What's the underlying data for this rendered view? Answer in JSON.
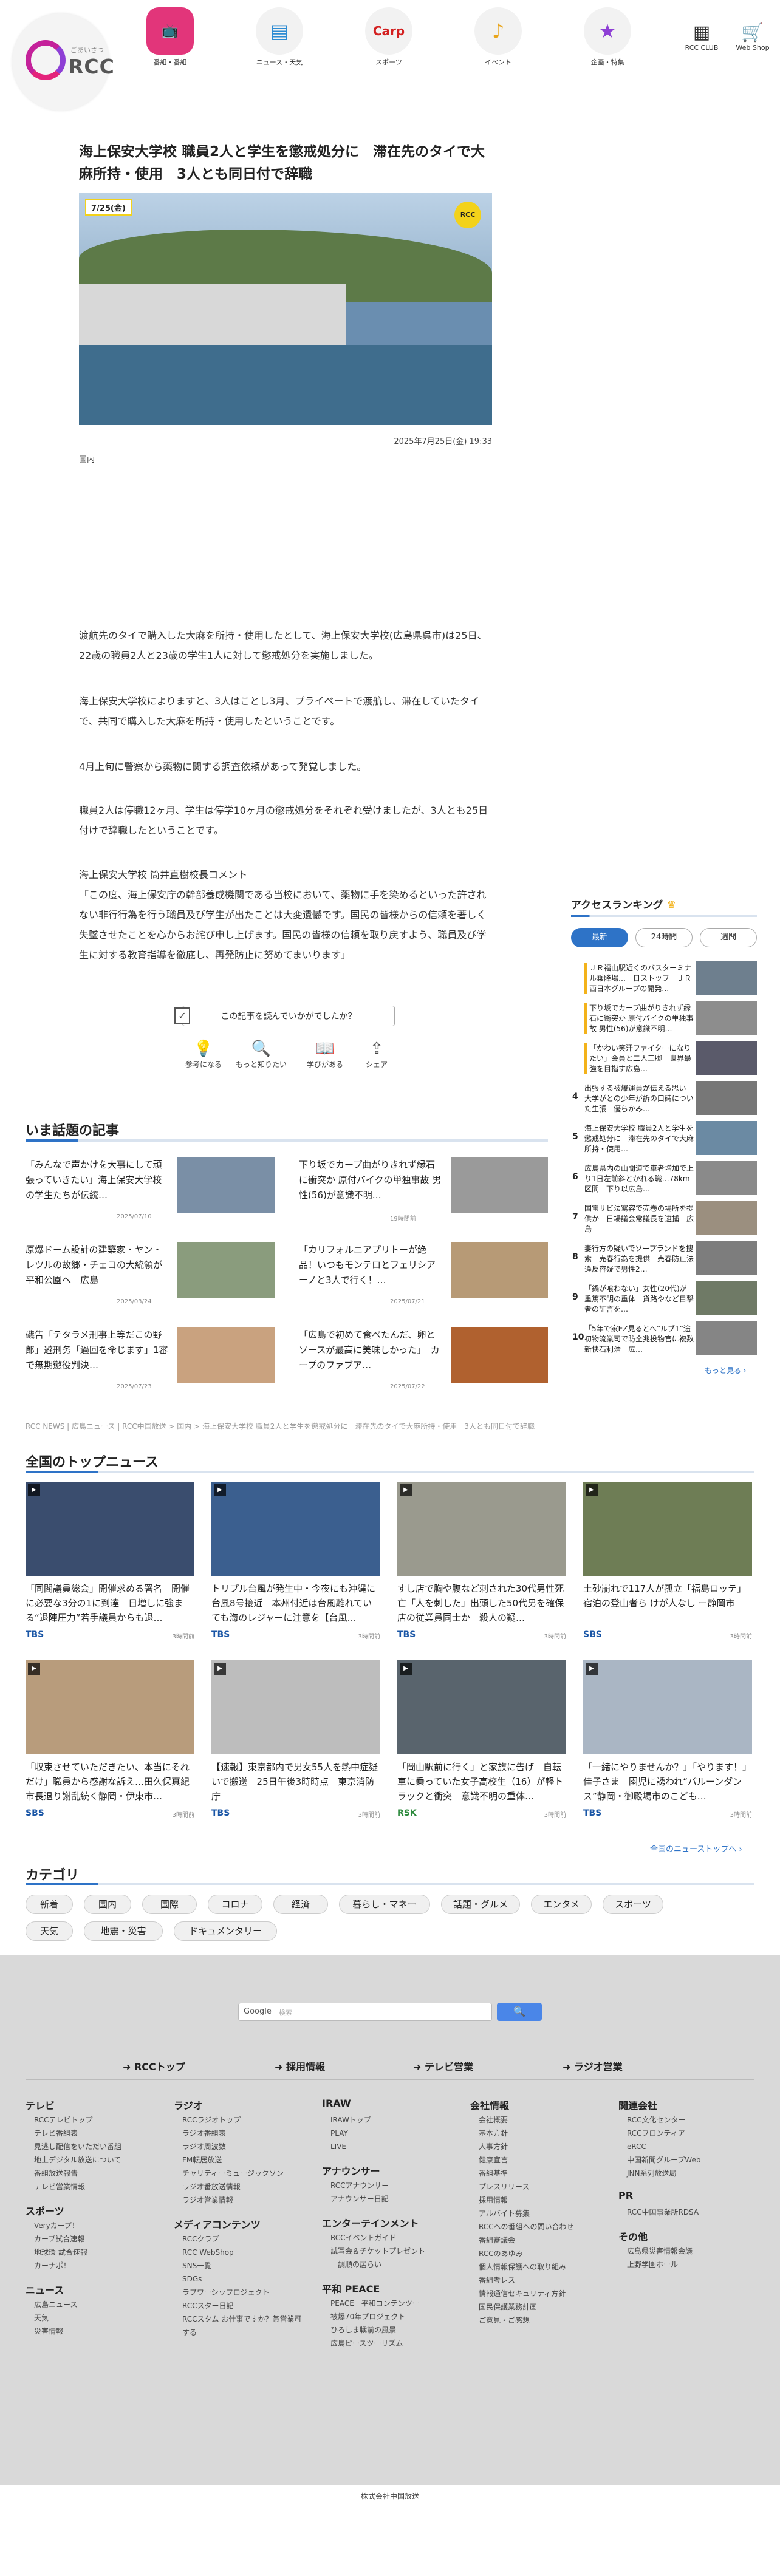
{
  "header": {
    "logo_small": "ごあいさつ",
    "logo_text": "RCC",
    "nav": [
      {
        "label": "番組・番組",
        "icon": "tv-icon",
        "active": true
      },
      {
        "label": "ニュース・天気",
        "icon": "news-icon"
      },
      {
        "label": "スポーツ",
        "icon": "carp-icon"
      },
      {
        "label": "イベント",
        "icon": "music-icon"
      },
      {
        "label": "企画・特集",
        "icon": "star-icon"
      }
    ],
    "club": "RCC CLUB",
    "shop": "Web Shop"
  },
  "article": {
    "title": "海上保安大学校 職員2人と学生を懲戒処分に　滞在先のタイで大麻所持・使用　3人とも同日付で辞職",
    "hero_date": "7/25(金)",
    "hero_logo": "RCC",
    "date": "2025年7月25日(金) 19:33",
    "category": "国内",
    "paragraphs": [
      "渡航先のタイで購入した大麻を所持・使用したとして、海上保安大学校(広島県呉市)は25日、22歳の職員2人と23歳の学生1人に対して懲戒処分を実施しました。",
      "海上保安大学校によりますと、3人はことし3月、プライベートで渡航し、滞在していたタイで、共同で購入した大麻を所持・使用したということです。",
      "4月上旬に警察から薬物に関する調査依頼があって発覚しました。",
      "職員2人は停職12ヶ月、学生は停学10ヶ月の懲戒処分をそれぞれ受けましたが、3人とも25日付けで辞職したということです。",
      "海上保安大学校 筒井直樹校長コメント\n「この度、海上保安庁の幹部養成機関である当校において、薬物に手を染めるといった許されない非行行為を行う職員及び学生が出たことは大変遺憾です。国民の皆様からの信頼を著しく失墜させたことを心からお詫び申し上げます。国民の皆様の信頼を取り戻すよう、職員及び学生に対する教育指導を徹底し、再発防止に努めてまいります」"
    ],
    "survey": "この記事を読んでいかがでしたか？",
    "reactions": [
      {
        "label": "参考になる",
        "icon": "lightbulb-icon"
      },
      {
        "label": "もっと知りたい",
        "icon": "magnifier-icon"
      },
      {
        "label": "学びがある",
        "icon": "book-icon"
      },
      {
        "label": "シェア",
        "icon": "share-icon"
      }
    ]
  },
  "trending": {
    "heading": "いま話題の記事",
    "items": [
      {
        "text": "「みんなで声かけを大事にして頑張っていきたい」海上保安大学校の学生たちが伝統…",
        "date": "2025/07/10"
      },
      {
        "text": "下り坂でカープ曲がりきれず縁石に衝突か 原付バイクの単独事故 男性(56)が意識不明…",
        "date": "19時間前"
      },
      {
        "text": "原爆ドーム設計の建築家・ヤン・レツルの故郷・チェコの大統領が平和公園へ　広島",
        "date": "2025/03/24"
      },
      {
        "text": "「カリフォルニアプリトーが絶品！いつもモンテロとフェリシアーノと3人で行く！…",
        "date": "2025/07/21"
      },
      {
        "text": "磯告「テタラメ刑事上等だこの野郎」避刑务「過回を命じます」1審で無期懲役判決…",
        "date": "2025/07/23"
      },
      {
        "text": "「広島で初めて食べたんだ、卵とソースが最高に美味しかった」　カープのファブア…",
        "date": "2025/07/22"
      }
    ]
  },
  "ranking": {
    "heading": "アクセスランキング",
    "tabs": [
      "最新",
      "24時間",
      "週間"
    ],
    "items": [
      "ＪＲ福山駅近くのバスターミナル乗降場…一日ストップ　ＪＲ西日本グループの開発…",
      "下り坂でカープ曲がりきれず縁石に衝突か 原付バイクの単独事故 男性(56)が意識不明…",
      "「かわい笑汗ファイターになりたい」会員と二人三脚　世界最強を目指す広島…",
      "出張する被爆運員が伝える思い　大学がとの少年が訴の口碑についた生張　優らかみ…",
      "海上保安大学校 職員2人と学生を懲戒処分に　滞在先のタイで大麻所持・使用…",
      "広島県内の山間道で車者増加で上り1日左前斜とかれる職…78km区間　下り以広島…",
      "国宝サビ法寫容で売巻の場所を提供か　日場議会常議長を逮捕　広島",
      "妻行方の疑いでソープランドを捜索　売春行為を提供　売春防止法違反容疑で男性2…",
      "「鍋が喰わない」女性(20代)が重篤不明の重体　貨路やなど目撃者の証言を…",
      "「5年で家EZ見るとへ”ルブ1”途初物流業司で防全兆投物官に複数新快石利浩　広…"
    ],
    "more": "もっと見る"
  },
  "breadcrumb": "RCC NEWS | 広島ニュース | RCC中国放送 > 国内 > 海上保安大学校 職員2人と学生を懲戒処分に　滞在先のタイで大麻所持・使用　3人とも同日付で辞職",
  "national": {
    "heading": "全国のトップニュース",
    "items": [
      {
        "text": "「同閣議員総会」開催求める署名　開催に必要な3分の1に到達　日増しに強まる“退陣圧力”若手議員からも退…",
        "src": "TBS",
        "date": "3時間前"
      },
      {
        "text": "トリプル台風が発生中・今夜にも沖縄に台風8号接近　本州付近は台風離れていても海のレジャーに注意を【台風…",
        "src": "TBS",
        "date": "3時間前"
      },
      {
        "text": "すし店で胸や腹など刺された30代男性死亡「人を刺した」出頭した50代男を確保　店の従業員同士か　殺人の疑…",
        "src": "TBS",
        "date": "3時間前"
      },
      {
        "text": "土砂崩れで117人が孤立「福島ロッテ」宿泊の登山者ら けが人なし ー静岡市",
        "src": "SBS",
        "date": "3時間前"
      },
      {
        "text": "「収束させていただきたい、本当にそれだけ」職員から感謝な訴え…田久保真紀市長退り謝乱続く静岡・伊東市…",
        "src": "SBS",
        "date": "3時間前"
      },
      {
        "text": "【速報】東京都内で男女55人を熱中症疑いで搬送　25日午後3時時点　東京消防庁",
        "src": "TBS",
        "date": "3時間前"
      },
      {
        "text": "「岡山駅前に行く」と家族に告げ　自転車に乗っていた女子高校生（16）が軽トラックと衝突　意識不明の重体…",
        "src": "RSK",
        "date": "3時間前"
      },
      {
        "text": "「一緒にやりませんか？」「やります！」佳子さま　園児に誘われ“バルーンダンス”静岡・御殿場市のこども…",
        "src": "TBS",
        "date": "3時間前"
      }
    ],
    "more": "全国のニューストップへ"
  },
  "categories": {
    "heading": "カテゴリ",
    "items": [
      "新着",
      "国内",
      "国際",
      "コロナ",
      "経済",
      "暮らし・マネー",
      "話題・グルメ",
      "エンタメ",
      "スポーツ",
      "天気",
      "地震・災害",
      "ドキュメンタリー"
    ]
  },
  "footer": {
    "search_brand": "Google",
    "search_placeholder": "検索",
    "links": [
      "RCCトップ",
      "採用情報",
      "テレビ営業",
      "ラジオ営業"
    ],
    "columns": [
      {
        "sections": [
          {
            "h": "テレビ",
            "items": [
              "RCCテレビトップ",
              "テレビ番組表",
              "見逃し配信をいただい番組",
              "地上デジタル放送について",
              "番組放送報告",
              "テレビ営業情報"
            ]
          },
          {
            "h": "スポーツ",
            "items": [
              "Veryカープ！",
              "カープ試合速報",
              "地球環 試合速報",
              "カーナポ！"
            ]
          },
          {
            "h": "ニュース",
            "items": [
              "広島ニュース",
              "天気",
              "災害情報"
            ]
          }
        ]
      },
      {
        "sections": [
          {
            "h": "ラジオ",
            "items": [
              "RCCラジオトップ",
              "ラジオ番組表",
              "ラジオ周波数",
              "FM転居放送",
              "チャリティーミュージックソン",
              "ラジオ番放送情報",
              "ラジオ営業情報"
            ]
          },
          {
            "h": "メディアコンテンツ",
            "items": [
              "RCCクラブ",
              "RCC WebShop",
              "SNS一覧",
              "SDGs",
              "ラブワーシップロジェクト",
              "RCCスター日記",
              "RCCスタム お仕事ですか？帯営業可する"
            ]
          }
        ]
      },
      {
        "sections": [
          {
            "h": "IRAW",
            "items": [
              "IRAWトップ",
              "PLAY",
              "LIVE"
            ]
          },
          {
            "h": "アナウンサー",
            "items": [
              "RCCアナウンサー",
              "アナウンサー日記"
            ]
          },
          {
            "h": "エンターテインメント",
            "items": [
              "RCCイベントガイド",
              "試写会＆チケットプレゼント",
              "一調順の居らい"
            ]
          },
          {
            "h": "平和 PEACE",
            "items": [
              "PEACE－平和コンテンツー",
              "被爆70年プロジェクト",
              "ひろしま戦前の風景",
              "広島ピースツーリズム"
            ]
          }
        ]
      },
      {
        "sections": [
          {
            "h": "会社情報",
            "items": [
              "会社概要",
              "基本方針",
              "人事方針",
              "健康宣言",
              "番組基準",
              "プレスリリース",
              "採用情報",
              "アルバイト募集",
              "RCCへの番組への問い合わせ",
              "番組審議会",
              "RCCのあゆみ",
              "個人情報保護への取り組み",
              "番組考レス",
              "情報通信セキュリティ方針",
              "国民保護業務計画",
              "ご意見・ご感想"
            ]
          }
        ]
      },
      {
        "sections": [
          {
            "h": "関連会社",
            "items": [
              "RCC文化センター",
              "RCCフロンティア",
              "eRCC",
              "中国新聞グループWeb",
              "JNN系列放送局"
            ]
          },
          {
            "h": "PR",
            "items": [
              "RCC中国事業所RDSA"
            ]
          },
          {
            "h": "その他",
            "items": [
              "広島県災害情報会議",
              "上野学園ホール"
            ]
          }
        ]
      }
    ],
    "copyright": "株式会社中国放送"
  },
  "colors": {
    "accent": "#2e73c7",
    "brand": "#c4219a",
    "rank_gold": "#f3b21a"
  }
}
